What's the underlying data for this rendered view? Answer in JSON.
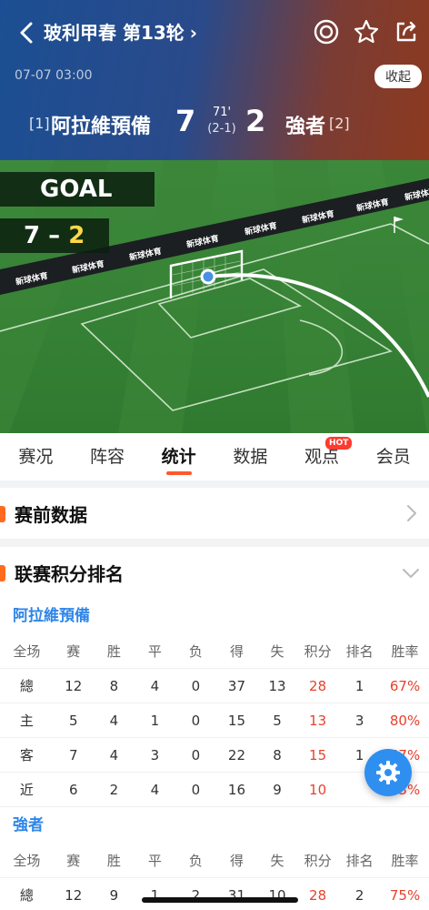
{
  "header": {
    "title": "玻利甲春 第13轮",
    "date": "07-07 03:00",
    "collapse_label": "收起",
    "home": {
      "rank": "[1]",
      "name": "阿拉維預備",
      "score": "7"
    },
    "away": {
      "rank": "[2]",
      "name": "強者",
      "score": "2"
    },
    "minute": "71'",
    "half_time": "(2-1)",
    "icons": [
      "target-icon",
      "star-icon",
      "share-icon"
    ]
  },
  "pitch": {
    "event_label": "GOAL",
    "score_home": "7",
    "score_sep": "–",
    "score_away": "2",
    "board_text": "新球体育"
  },
  "tabs": [
    {
      "label": "赛况"
    },
    {
      "label": "阵容"
    },
    {
      "label": "统计",
      "active": true
    },
    {
      "label": "数据"
    },
    {
      "label": "观点",
      "badge": "HOT"
    },
    {
      "label": "会员"
    }
  ],
  "pre_match": {
    "title": "赛前数据"
  },
  "standings": {
    "title": "联赛积分排名",
    "columns": [
      "全场",
      "赛",
      "胜",
      "平",
      "负",
      "得",
      "失",
      "积分",
      "排名",
      "胜率"
    ],
    "teams": [
      {
        "name": "阿拉維預備",
        "rows": [
          [
            "總",
            "12",
            "8",
            "4",
            "0",
            "37",
            "13",
            "28",
            "1",
            "67%"
          ],
          [
            "主",
            "5",
            "4",
            "1",
            "0",
            "15",
            "5",
            "13",
            "3",
            "80%"
          ],
          [
            "客",
            "7",
            "4",
            "3",
            "0",
            "22",
            "8",
            "15",
            "1",
            "57%"
          ],
          [
            "近",
            "6",
            "2",
            "4",
            "0",
            "16",
            "9",
            "10",
            "",
            "33%"
          ]
        ]
      },
      {
        "name": "強者",
        "rows": [
          [
            "總",
            "12",
            "9",
            "1",
            "2",
            "31",
            "10",
            "28",
            "2",
            "75%"
          ]
        ]
      }
    ]
  },
  "colors": {
    "accent": "#ff6a1f",
    "team_blue": "#2f86e8",
    "points_red": "#e8412d",
    "fab_blue": "#2f8ff0"
  }
}
